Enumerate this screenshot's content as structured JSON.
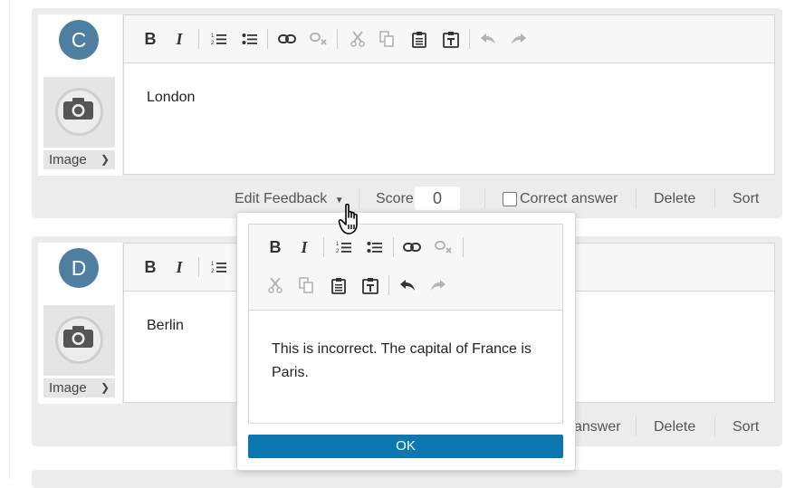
{
  "answers": [
    {
      "letter": "C",
      "text": "London",
      "image_select": "Image",
      "edit_feedback": "Edit Feedback",
      "score_label": "Score",
      "score_value": "0",
      "correct_label": "Correct answer",
      "delete_label": "Delete",
      "sort_label": "Sort"
    },
    {
      "letter": "D",
      "text": "Berlin",
      "image_select": "Image",
      "correct_label_partial": "answer",
      "delete_label": "Delete",
      "sort_label": "Sort"
    }
  ],
  "feedback_popup": {
    "text": "This is incorrect. The capital of France is Paris.",
    "ok_label": "OK"
  },
  "colors": {
    "avatar": "#4e7fa1",
    "ok_button": "#0c77b1",
    "card_bg": "#ececec"
  },
  "icons": {
    "toolbar": [
      "bold",
      "italic",
      "numbered-list",
      "bullet-list",
      "link",
      "unlink",
      "cut",
      "copy",
      "paste",
      "paste-text",
      "undo",
      "redo"
    ],
    "image_placeholder": "camera-icon",
    "cursor": "hand-pointer-icon"
  }
}
